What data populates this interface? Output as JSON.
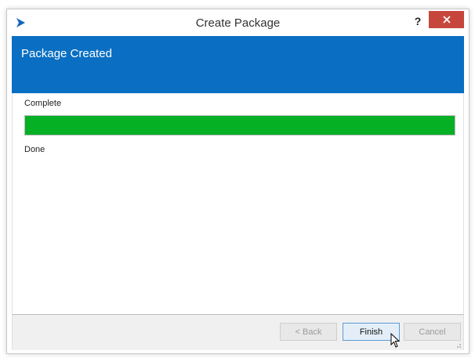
{
  "window": {
    "title": "Create Package",
    "help_label": "?",
    "close_icon": "close-icon",
    "logo_icon": "app-logo-icon"
  },
  "header": {
    "title": "Package Created",
    "color": "#0a6fc2"
  },
  "progress": {
    "status_label": "Complete",
    "percent": 100,
    "fill_color": "#06b025",
    "detail_label": "Done"
  },
  "footer": {
    "back_label": "< Back",
    "finish_label": "Finish",
    "cancel_label": "Cancel"
  },
  "colors": {
    "close_button": "#c7463b",
    "accent": "#0a6fc2"
  }
}
